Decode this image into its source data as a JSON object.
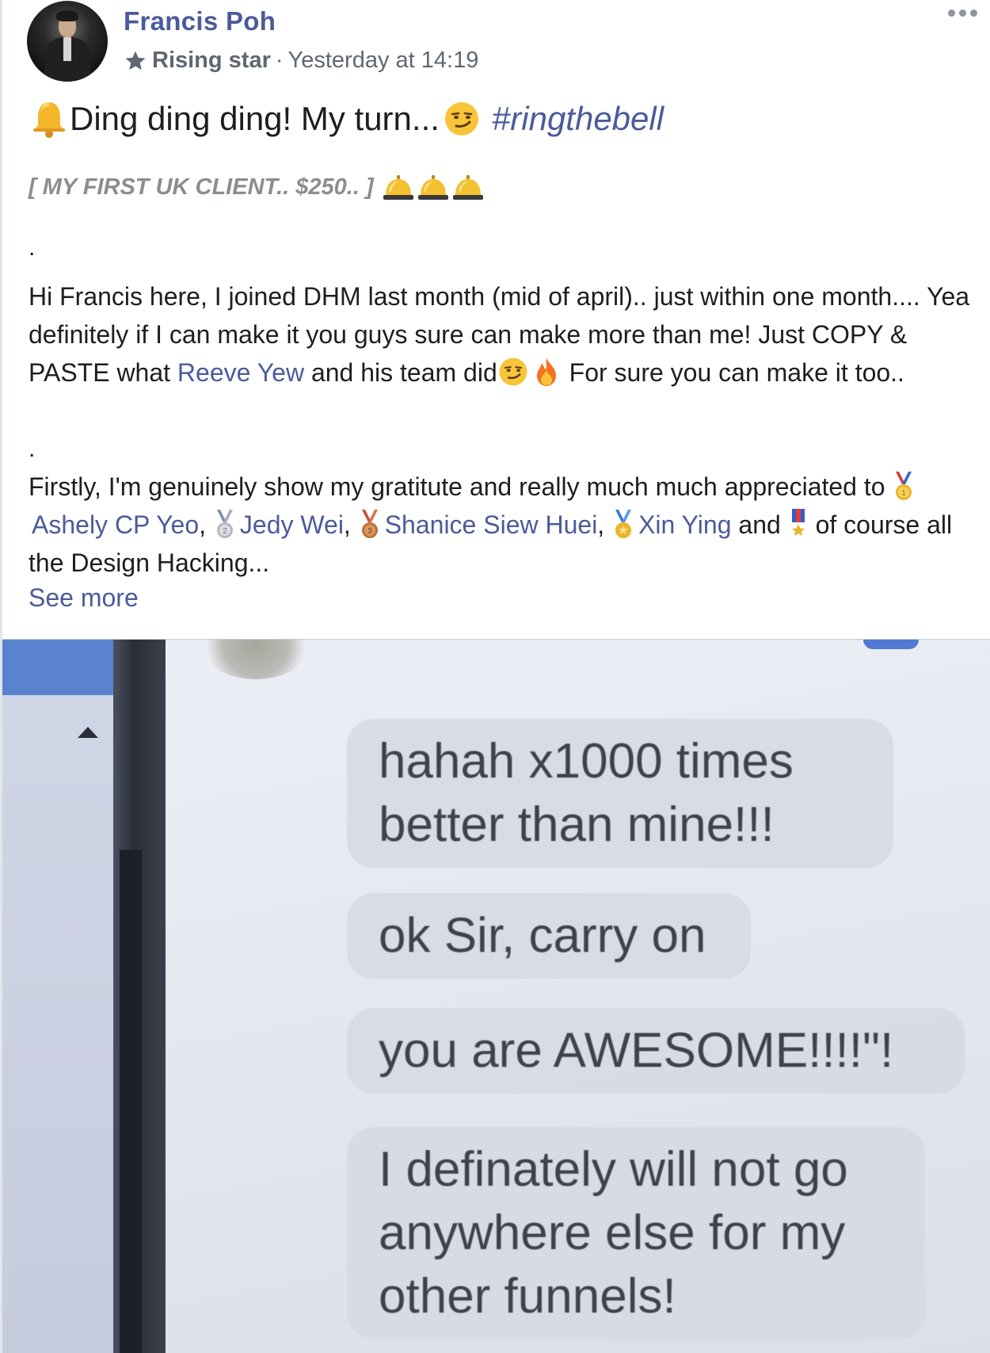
{
  "post": {
    "author": "Francis Poh",
    "badge": "Rising star",
    "separator": "·",
    "timestamp": "Yesterday at 14:19",
    "headline_text": "Ding ding ding! My turn...",
    "hashtag": "#ringthebell",
    "subhead": "[ MY FIRST UK CLIENT.. $250.. ]",
    "dot": ".",
    "para1_a": "Hi Francis here, I joined DHM last month (mid of april).. just within one month.... Yea definitely if I can make it you guys sure can make more than me! Just COPY & PASTE what ",
    "para1_link": "Reeve Yew",
    "para1_b": " and his team did",
    "para1_c": " For sure you can make it too..",
    "para2_a": "Firstly, I'm genuinely show my gratitute and really much much appreciated to ",
    "mention_1": "Ashely CP Yeo",
    "comma": ", ",
    "mention_2": "Jedy Wei",
    "mention_3": "Shanice Siew Huei",
    "mention_4": "Xin Ying",
    "and": " and ",
    "para2_end": " of course all the Design Hacking...",
    "see_more": "See more"
  },
  "photo": {
    "messages": [
      "hahah x1000 times\nbetter than mine!!!",
      "ok Sir, carry on",
      "you are AWESOME!!!!\"!",
      "I definately will not go\nanywhere else for my\nother funnels!"
    ]
  },
  "colors": {
    "link": "#4b5b9a",
    "text": "#1c1e21",
    "meta": "#606770"
  },
  "icons": [
    "star-icon",
    "bell-emoji",
    "smirk-emoji",
    "service-bell-emoji",
    "fire-emoji",
    "gold-medal-emoji",
    "silver-medal-emoji",
    "bronze-medal-emoji",
    "sports-medal-emoji",
    "military-medal-emoji",
    "more-options-icon"
  ]
}
